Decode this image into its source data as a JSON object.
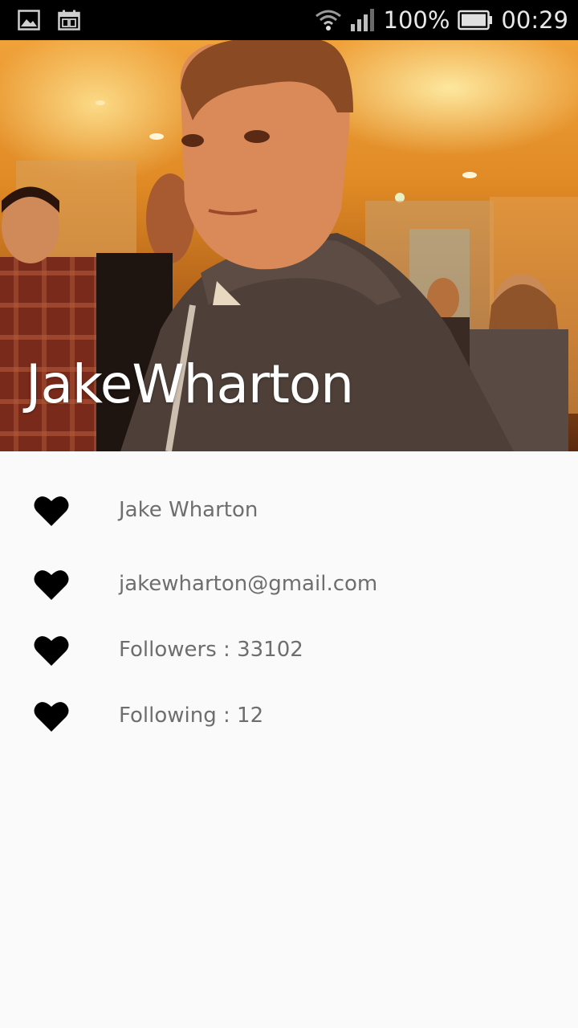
{
  "status_bar": {
    "battery_percent": "100%",
    "time": "00:29",
    "icons": [
      "image-icon",
      "calendar-icon",
      "wifi-icon",
      "signal-icon",
      "battery-icon"
    ]
  },
  "profile": {
    "username": "JakeWharton",
    "details": [
      {
        "icon": "heart-icon",
        "text": "Jake Wharton"
      },
      {
        "icon": "heart-icon",
        "text": "jakewharton@gmail.com"
      },
      {
        "icon": "heart-icon",
        "text": "Followers : 33102"
      },
      {
        "icon": "heart-icon",
        "text": "Following : 12"
      }
    ]
  },
  "colors": {
    "background": "#fafafa",
    "status_bar": "#000000",
    "detail_text": "#6e6e6e",
    "icon": "#000000"
  }
}
